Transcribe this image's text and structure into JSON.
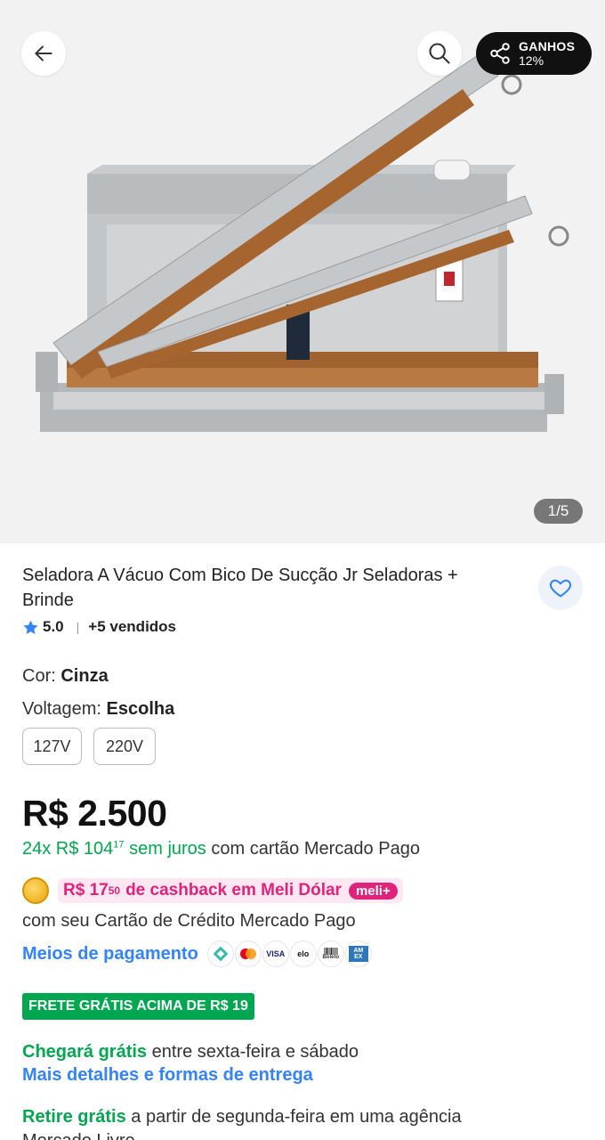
{
  "gallery": {
    "counter": "1/5",
    "share": {
      "label": "GANHOS",
      "value": "12%"
    }
  },
  "product": {
    "title": "Seladora A Vácuo Com Bico De Sucção Jr Seladoras + Brinde",
    "rating": "5.0",
    "sold": "+5 vendidos",
    "rating_stars": 5
  },
  "attributes": {
    "color_label": "Cor:",
    "color_value": "Cinza",
    "voltage_label": "Voltagem:",
    "voltage_value": "Escolha",
    "voltage_options": [
      "127V",
      "220V"
    ]
  },
  "pricing": {
    "price": "R$ 2.500",
    "installments_count": "24x R$ 104",
    "installments_cents": "17",
    "installments_free": "sem juros",
    "installments_suffix": "com cartão Mercado Pago",
    "cashback_amount": "R$ 17",
    "cashback_cents": "50",
    "cashback_text": "de cashback em Meli Dólar",
    "meli_badge": "meli+",
    "cashback_sub": "com seu Cartão de Crédito Mercado Pago",
    "payment_link": "Meios de pagamento",
    "payment_methods": [
      "pix-icon",
      "mastercard-icon",
      "visa-icon",
      "elo-icon",
      "boleto-icon",
      "amex-icon"
    ],
    "payment_labels": {
      "visa": "VISA",
      "elo": "elo",
      "boleto": "Boleto",
      "amex": "AM EX"
    }
  },
  "shipping": {
    "free_badge": "FRETE GRÁTIS ACIMA DE R$ 19",
    "arrival_strong": "Chegará grátis",
    "arrival_rest": "entre sexta-feira e sábado",
    "details_link": "Mais detalhes e formas de entrega",
    "pickup_strong": "Retire grátis",
    "pickup_rest": "a partir de segunda-feira em uma agência",
    "pickup_cut": "Mercado Livre"
  },
  "colors": {
    "brand_blue": "#3483fa",
    "green": "#00a650",
    "pink": "#e0227a"
  }
}
